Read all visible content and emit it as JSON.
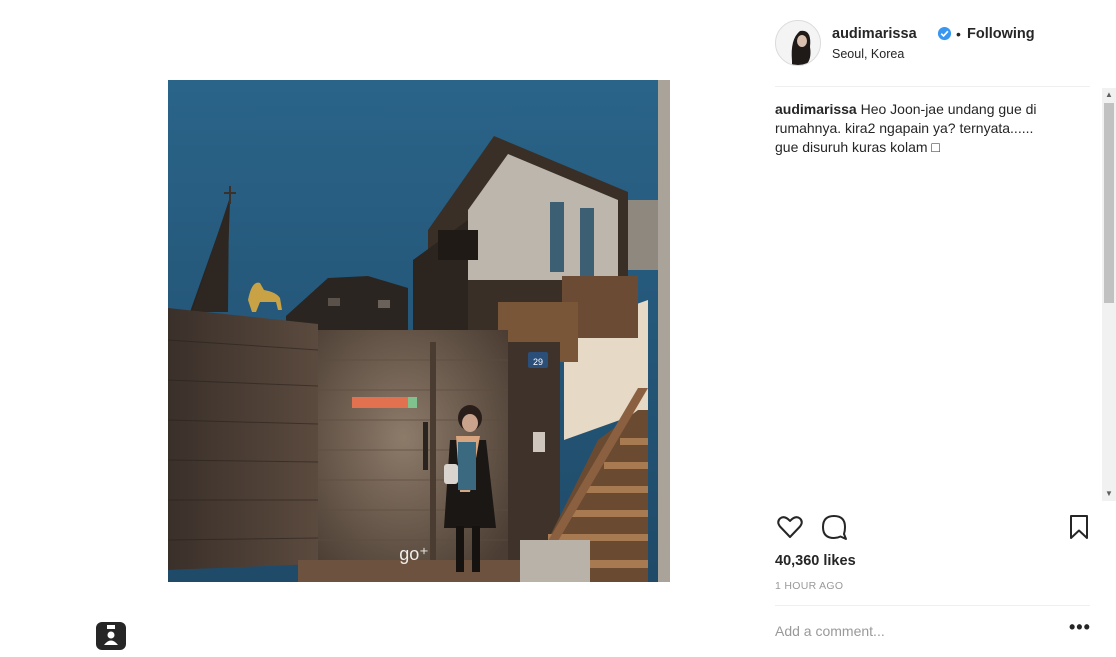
{
  "post": {
    "username": "audimarissa",
    "follow_state": "Following",
    "separator": "•",
    "location": "Seoul, Korea",
    "caption_user": "audimarissa",
    "caption_text": " Heo Joon-jae undang gue di rumahnya. kira2 ngapain ya? ternyata...... gue disuruh kuras kolam □",
    "likes": "40,360 likes",
    "time": "1 HOUR AGO",
    "comment_placeholder": "Add a comment...",
    "more_glyph": "•••",
    "photo_watermark": "go⁺",
    "house_number": "29"
  },
  "colors": {
    "sky": "#2a6186",
    "verified": "#3897f0",
    "text": "#262626",
    "muted": "#999999"
  },
  "icons": [
    "tag-user-icon",
    "verified-badge-icon",
    "heart-icon",
    "comment-bubble-icon",
    "bookmark-icon",
    "more-options-icon"
  ]
}
